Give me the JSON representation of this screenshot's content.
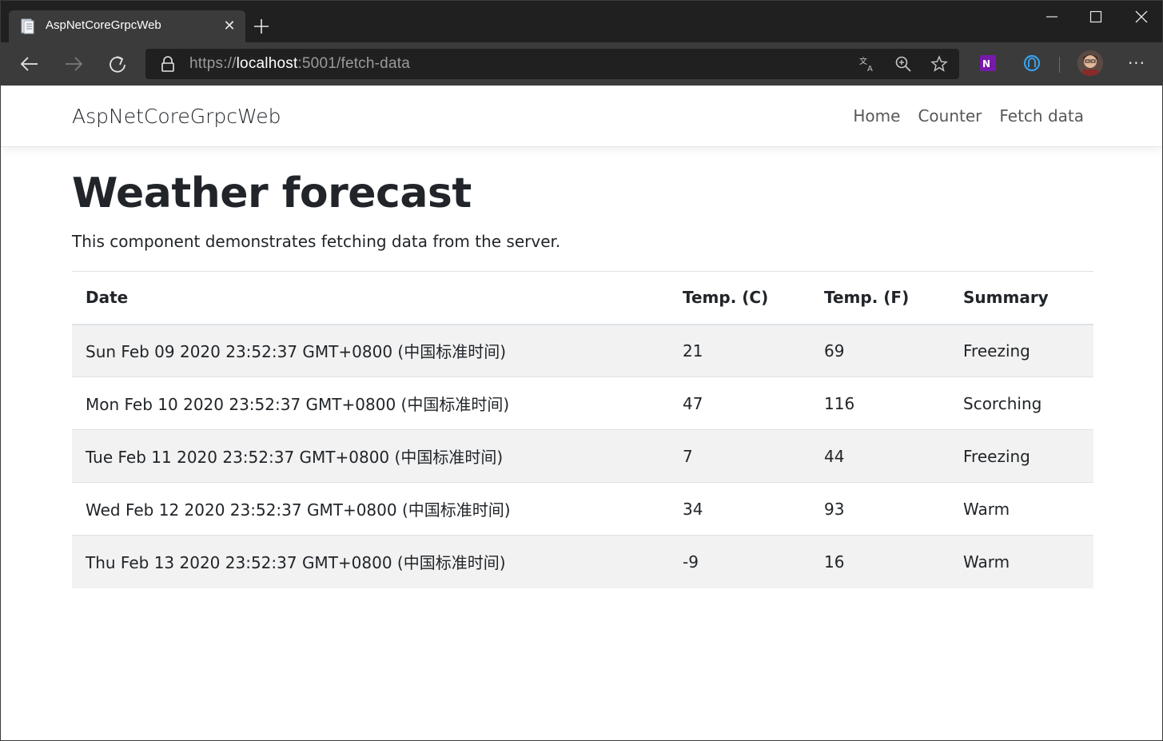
{
  "browser": {
    "tab": {
      "title": "AspNetCoreGrpcWeb",
      "close_glyph": "✕"
    },
    "address": {
      "scheme": "https://",
      "host": "localhost",
      "rest": ":5001/fetch-data"
    },
    "more_glyph": "···"
  },
  "navbar": {
    "brand": "AspNetCoreGrpcWeb",
    "links": [
      "Home",
      "Counter",
      "Fetch data"
    ]
  },
  "main": {
    "title": "Weather forecast",
    "description": "This component demonstrates fetching data from the server.",
    "table": {
      "headers": [
        "Date",
        "Temp. (C)",
        "Temp. (F)",
        "Summary"
      ],
      "rows": [
        [
          "Sun Feb 09 2020 23:52:37 GMT+0800 (中国标准时间)",
          "21",
          "69",
          "Freezing"
        ],
        [
          "Mon Feb 10 2020 23:52:37 GMT+0800 (中国标准时间)",
          "47",
          "116",
          "Scorching"
        ],
        [
          "Tue Feb 11 2020 23:52:37 GMT+0800 (中国标准时间)",
          "7",
          "44",
          "Freezing"
        ],
        [
          "Wed Feb 12 2020 23:52:37 GMT+0800 (中国标准时间)",
          "34",
          "93",
          "Warm"
        ],
        [
          "Thu Feb 13 2020 23:52:37 GMT+0800 (中国标准时间)",
          "-9",
          "16",
          "Warm"
        ]
      ]
    }
  },
  "colors": {
    "chrome_dark": "#202020",
    "chrome_toolbar": "#3b3b3b",
    "text": "#212529",
    "stripe": "#f2f2f2"
  }
}
